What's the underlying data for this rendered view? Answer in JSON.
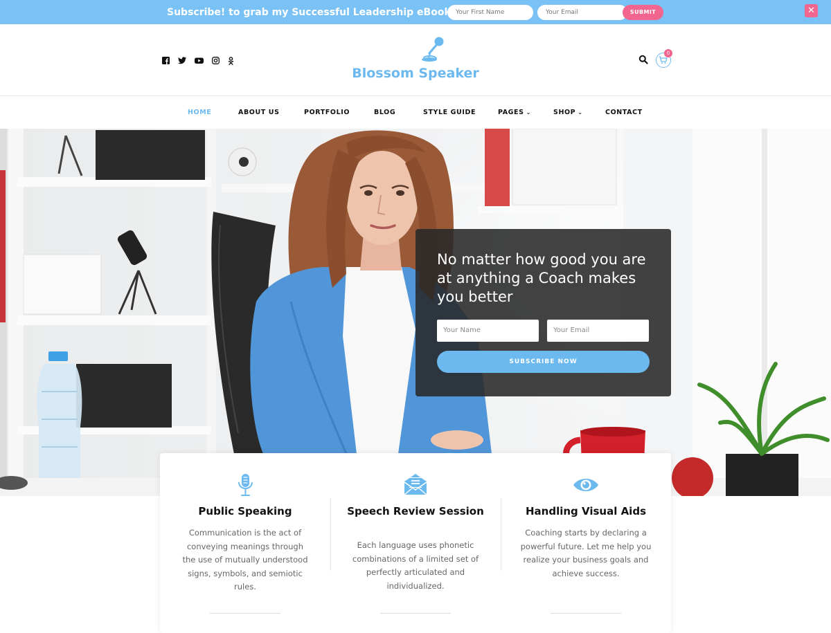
{
  "topbar": {
    "text": "Subscribe! to grab my Successful Leadership eBook!",
    "first_name_placeholder": "Your First Name",
    "email_placeholder": "Your Email",
    "submit_label": "SUBMIT",
    "close_label": "✕"
  },
  "header": {
    "site_title": "Blossom Speaker",
    "social_icons": [
      "facebook-icon",
      "twitter-icon",
      "youtube-icon",
      "instagram-icon",
      "odnoklassniki-icon"
    ],
    "cart_count": "0"
  },
  "nav": {
    "items": [
      {
        "label": "HOME",
        "active": true
      },
      {
        "label": "ABOUT US"
      },
      {
        "label": "PORTFOLIO"
      },
      {
        "label": "BLOG"
      },
      {
        "label": "STYLE GUIDE"
      },
      {
        "label": "PAGES",
        "dropdown": true
      },
      {
        "label": "SHOP",
        "dropdown": true
      },
      {
        "label": "CONTACT"
      }
    ],
    "dropdown_glyph": "⌄"
  },
  "hero": {
    "title": "No matter how good you are at anything a Coach makes you better",
    "name_placeholder": "Your Name",
    "email_placeholder": "Your Email",
    "button_label": "SUBSCRIBE NOW"
  },
  "services": [
    {
      "icon": "microphone-icon",
      "title": "Public Speaking",
      "description": "Communication is the act of conveying meanings through the use of mutually understood signs, symbols, and semiotic rules."
    },
    {
      "icon": "mail-icon",
      "title": "Speech Review Session",
      "description": "Each language uses phonetic combinations of a limited set of perfectly articulated and individualized."
    },
    {
      "icon": "eye-icon",
      "title": "Handling Visual Aids",
      "description": "Coaching starts by declaring a powerful future. Let me help you realize your business goals and achieve success."
    }
  ],
  "colors": {
    "accent": "#6cb9ef",
    "topbar": "#7ac2f5",
    "pink": "#f2658e",
    "overlay": "#282828"
  }
}
